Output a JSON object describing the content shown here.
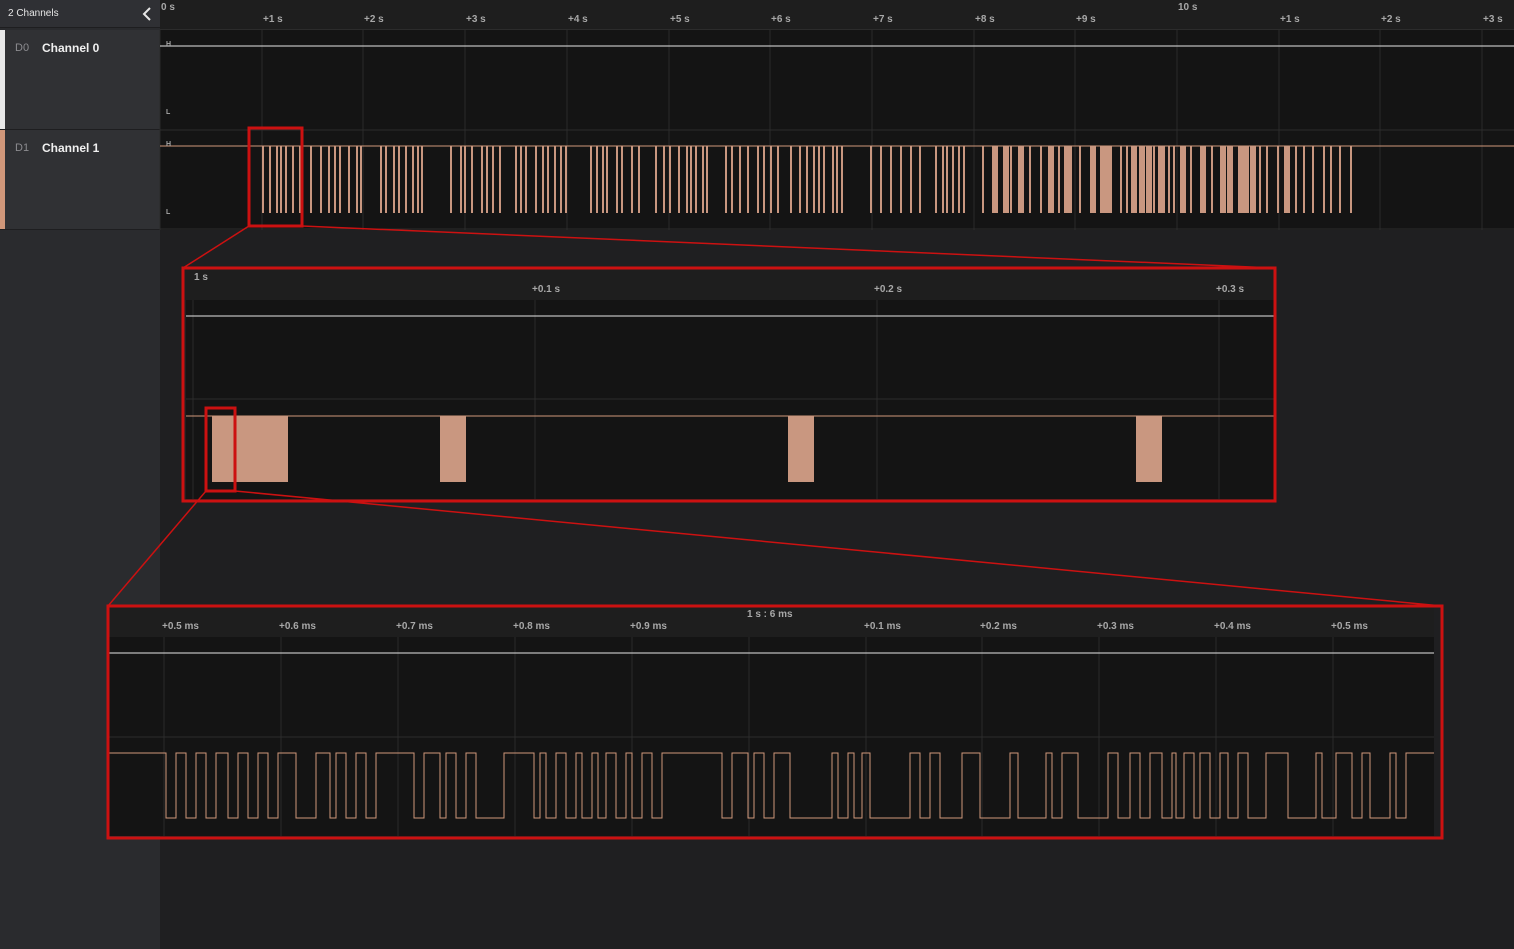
{
  "sidebar": {
    "header_label": "2 Channels",
    "channels": [
      {
        "id": "D0",
        "name": "Channel 0",
        "color": "#e8e8e8"
      },
      {
        "id": "D1",
        "name": "Channel 1",
        "color": "#d0977a"
      }
    ]
  },
  "icons": {
    "collapse": "chevron-left-icon"
  },
  "colors": {
    "signal": "#d0977a",
    "signal_fill": "#c99780",
    "flat": "#e6e6e6",
    "zoom_box": "#cc1111"
  },
  "main": {
    "ruler_labels": [
      "0 s",
      "+1 s",
      "+2 s",
      "+3 s",
      "+4 s",
      "+5 s",
      "+6 s",
      "+7 s",
      "+8 s",
      "+9 s",
      "10 s",
      "+1 s",
      "+2 s",
      "+3 s"
    ],
    "level_high": "H",
    "level_low": "L"
  },
  "zoom1": {
    "ruler_labels": [
      "1 s",
      "+0.1 s",
      "+0.2 s",
      "+0.3 s"
    ]
  },
  "zoom2": {
    "ruler_labels": [
      "+0.5 ms",
      "+0.6 ms",
      "+0.7 ms",
      "+0.8 ms",
      "+0.9 ms",
      "1 s : 6 ms",
      "+0.1 ms",
      "+0.2 ms",
      "+0.3 ms",
      "+0.4 ms",
      "+0.5 ms"
    ]
  }
}
